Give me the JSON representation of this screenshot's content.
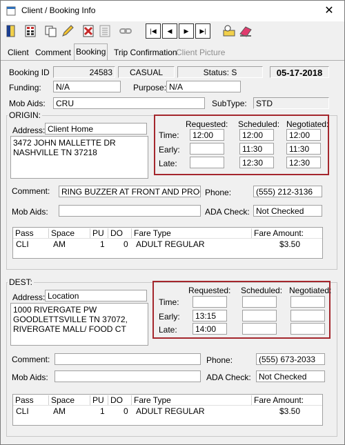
{
  "window": {
    "title": "Client / Booking Info",
    "close_glyph": "✕"
  },
  "toolbar": [
    {
      "name": "exit-icon"
    },
    {
      "name": "calculator-icon"
    },
    {
      "name": "copy-icon"
    },
    {
      "name": "edit-icon"
    },
    {
      "name": "delete-icon"
    },
    {
      "name": "list-icon"
    },
    {
      "name": "link-icon"
    },
    {
      "name": "first-record-icon",
      "glyph": "|◀"
    },
    {
      "name": "prev-record-icon",
      "glyph": "◀"
    },
    {
      "name": "next-record-icon",
      "glyph": "▶"
    },
    {
      "name": "last-record-icon",
      "glyph": "▶|"
    },
    {
      "name": "search-icon"
    },
    {
      "name": "eraser-icon"
    }
  ],
  "tabs": [
    "Client",
    "Comment",
    "Booking",
    "Trip Confirmation",
    "Client Picture"
  ],
  "header": {
    "booking_id_label": "Booking ID",
    "booking_id": "24583",
    "booking_type": "CASUAL",
    "status": "Status: S",
    "date": "05-17-2018",
    "funding_label": "Funding:",
    "funding": "N/A",
    "purpose_label": "Purpose:",
    "purpose": "N/A",
    "mob_aids_label": "Mob Aids:",
    "mob_aids": "CRU",
    "subtype_label": "SubType:",
    "subtype": "STD"
  },
  "origin": {
    "group_label": "ORIGIN:",
    "address_label": "Address:",
    "address_type": "Client Home",
    "address_lines": [
      "3472 JOHN MALLETTE DR",
      "NASHVILLE TN 37218"
    ],
    "col_requested": "Requested:",
    "col_scheduled": "Scheduled:",
    "col_negotiated": "Negotiated:",
    "time_label": "Time:",
    "early_label": "Early:",
    "late_label": "Late:",
    "time": {
      "requested": "12:00",
      "scheduled": "12:00",
      "negotiated": "12:00"
    },
    "early": {
      "requested": "",
      "scheduled": "11:30",
      "negotiated": "11:30"
    },
    "late": {
      "requested": "",
      "scheduled": "12:30",
      "negotiated": "12:30"
    },
    "comment_label": "Comment:",
    "comment": "RING BUZZER AT FRONT AND PROCEE",
    "phone_label": "Phone:",
    "phone": "(555) 212-3136",
    "mob_aids_label": "Mob Aids:",
    "mob_aids": "",
    "ada_label": "ADA Check:",
    "ada": "Not Checked",
    "grid_headers": [
      "Pass",
      "Space",
      "PU",
      "DO",
      "Fare Type",
      "Fare Amount:"
    ],
    "grid_row": [
      "CLI",
      "AM",
      "1",
      "0",
      "ADULT REGULAR",
      "$3.50"
    ]
  },
  "dest": {
    "group_label": "DEST:",
    "address_label": "Address:",
    "address_type": "Location",
    "address_lines": [
      "1000 RIVERGATE PW",
      "GOODLETTSVILLE TN 37072,",
      "RIVERGATE MALL/ FOOD CT"
    ],
    "col_requested": "Requested:",
    "col_scheduled": "Scheduled:",
    "col_negotiated": "Negotiated:",
    "time_label": "Time:",
    "early_label": "Early:",
    "late_label": "Late:",
    "time": {
      "requested": "",
      "scheduled": "",
      "negotiated": ""
    },
    "early": {
      "requested": "13:15",
      "scheduled": "",
      "negotiated": ""
    },
    "late": {
      "requested": "14:00",
      "scheduled": "",
      "negotiated": ""
    },
    "comment_label": "Comment:",
    "comment": "",
    "phone_label": "Phone:",
    "phone": "(555) 673-2033",
    "mob_aids_label": "Mob Aids:",
    "mob_aids": "",
    "ada_label": "ADA Check:",
    "ada": "Not Checked",
    "grid_headers": [
      "Pass",
      "Space",
      "PU",
      "DO",
      "Fare Type",
      "Fare Amount:"
    ],
    "grid_row": [
      "CLI",
      "AM",
      "1",
      "0",
      "ADULT REGULAR",
      "$3.50"
    ]
  }
}
